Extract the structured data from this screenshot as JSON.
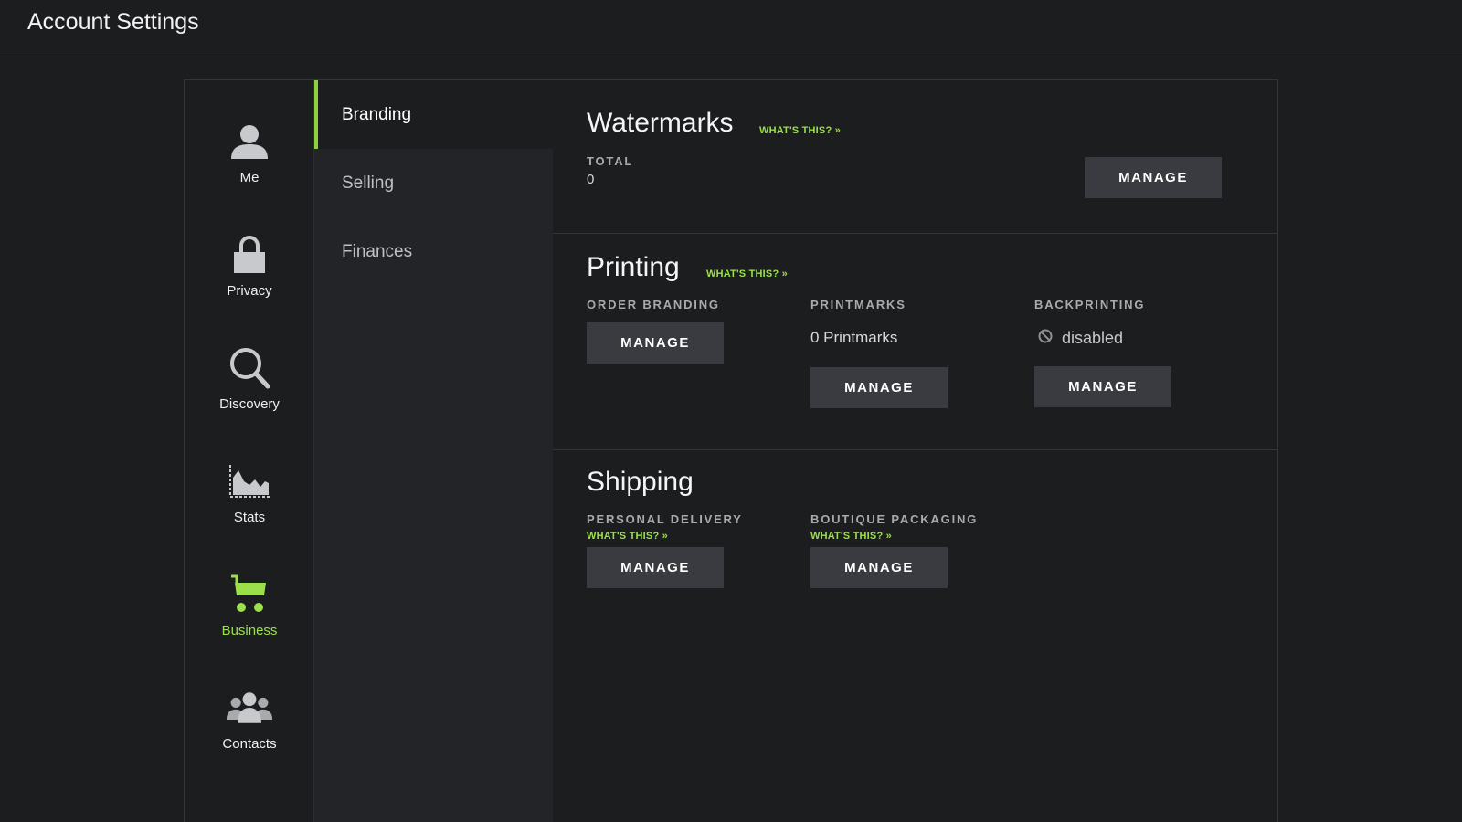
{
  "header": {
    "title": "Account Settings"
  },
  "sidebar": {
    "items": [
      {
        "label": "Me",
        "icon": "user-icon"
      },
      {
        "label": "Privacy",
        "icon": "lock-icon"
      },
      {
        "label": "Discovery",
        "icon": "search-icon"
      },
      {
        "label": "Stats",
        "icon": "stats-chart-icon"
      },
      {
        "label": "Business",
        "icon": "cart-icon",
        "active": true
      },
      {
        "label": "Contacts",
        "icon": "contacts-icon"
      }
    ]
  },
  "subnav": {
    "items": [
      {
        "label": "Branding",
        "active": true
      },
      {
        "label": "Selling"
      },
      {
        "label": "Finances"
      }
    ]
  },
  "watermarks": {
    "title": "Watermarks",
    "whats_this": "WHAT'S THIS? »",
    "total_label": "TOTAL",
    "total_value": "0",
    "manage_label": "MANAGE"
  },
  "printing": {
    "title": "Printing",
    "whats_this": "WHAT'S THIS? »",
    "order_branding_label": "ORDER BRANDING",
    "order_branding_button": "MANAGE",
    "printmarks_label": "PRINTMARKS",
    "printmarks_value": "0 Printmarks",
    "printmarks_button": "MANAGE",
    "backprinting_label": "BACKPRINTING",
    "backprinting_status": "disabled",
    "backprinting_button": "MANAGE"
  },
  "shipping": {
    "title": "Shipping",
    "personal_delivery_label": "PERSONAL DELIVERY",
    "personal_delivery_whats": "WHAT'S THIS? »",
    "personal_delivery_button": "MANAGE",
    "boutique_packaging_label": "BOUTIQUE PACKAGING",
    "boutique_packaging_whats": "WHAT'S THIS? »",
    "boutique_packaging_button": "MANAGE"
  },
  "colors": {
    "accent": "#9be04a",
    "background": "#1c1d1f",
    "button": "#3a3b40"
  }
}
